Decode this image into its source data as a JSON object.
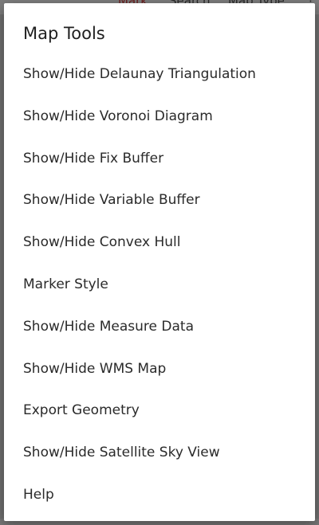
{
  "background": {
    "tabs": [
      "Mark",
      "Search",
      "Map Type",
      ""
    ]
  },
  "dialog": {
    "title": "Map Tools",
    "items": [
      "Show/Hide Delaunay Triangulation",
      "Show/Hide Voronoi Diagram",
      "Show/Hide Fix Buffer",
      "Show/Hide Variable Buffer",
      "Show/Hide Convex Hull",
      "Marker Style",
      "Show/Hide Measure Data",
      "Show/Hide WMS Map",
      "Export Geometry",
      "Show/Hide Satellite Sky View",
      "Help"
    ]
  },
  "colors": {
    "overlay": "#6f6f6f",
    "dialog_bg": "#ffffff",
    "text": "#2a2a2a",
    "mark_tab": "#6a1e1e"
  }
}
